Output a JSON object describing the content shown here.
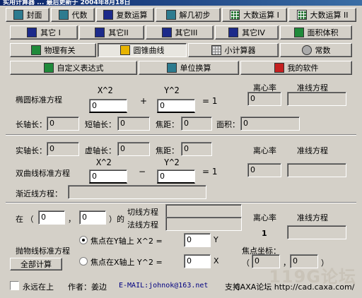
{
  "window": {
    "title_fragment": "实用计算器 ... 最后更新于 2004年8月18日"
  },
  "toolbar_row1": [
    {
      "label": "封面",
      "icon": "cover-icon"
    },
    {
      "label": "代数",
      "icon": "algebra-icon"
    },
    {
      "label": "复数运算",
      "icon": "complex-icon"
    },
    {
      "label": "解几初步",
      "icon": "analytic-geometry-icon"
    },
    {
      "label": "大数运算 I",
      "icon": "bignum-icon"
    },
    {
      "label": "大数运算 II",
      "icon": "bignum-icon"
    }
  ],
  "toolbar_row2": [
    {
      "label": "其它 I"
    },
    {
      "label": "其它II"
    },
    {
      "label": "其它III"
    },
    {
      "label": "其它IV"
    },
    {
      "label": "面积体积"
    }
  ],
  "tabs": [
    {
      "label": "物理有关"
    },
    {
      "label": "圆锥曲线",
      "active": true
    },
    {
      "label": "小计算器"
    },
    {
      "label": "常数"
    }
  ],
  "row4": [
    {
      "label": "自定义表达式"
    },
    {
      "label": "单位换算"
    },
    {
      "label": "我的软件"
    }
  ],
  "ellipse": {
    "title": "椭圆标准方程",
    "x2": "X^2",
    "y2": "Y^2",
    "plus": "+",
    "eq1": "= 1",
    "a_value": "0",
    "b_value": "0",
    "ecc_label": "离心率",
    "ecc_value": "0",
    "directrix_label": "准线方程",
    "major_label": "长轴长：",
    "major_value": "0",
    "minor_label": "短轴长：",
    "minor_value": "0",
    "focal_label": "焦距：",
    "focal_value": "0",
    "area_label": "面积：",
    "area_value": "0"
  },
  "hyperbola": {
    "real_label": "实轴长：",
    "real_value": "0",
    "imag_label": "虚轴长：",
    "imag_value": "0",
    "focal_label": "焦距：",
    "focal_value": "0",
    "ecc_label": "离心率",
    "directrix_label": "准线方程",
    "title": "双曲线标准方程",
    "x2": "X^2",
    "y2": "Y^2",
    "minus": "−",
    "eq1": "= 1",
    "a_value": "0",
    "b_value": "0",
    "ecc_value": "0",
    "asymptote_label": "渐近线方程："
  },
  "parabola": {
    "at_label": "在 （",
    "comma": "，",
    "x_value": "0",
    "y_value": "0",
    "paren_close": "）的",
    "tangent_label": "切线方程",
    "normal_label": "法线方程",
    "ecc_label": "离心率",
    "directrix_label": "准线方程",
    "ecc_value": "1",
    "title": "抛物线标准方程",
    "opt1_label": "焦点在Y轴上  X^2 =",
    "opt1_value": "0",
    "opt1_var": "Y",
    "opt2_label": "焦点在X轴上  Y^2 =",
    "opt2_value": "0",
    "opt2_var": "X",
    "focus_label": "焦点坐标：",
    "focus_open": "（",
    "focus_x": "0",
    "focus_comma": "，",
    "focus_y": "0",
    "focus_close": "）",
    "calc_all": "全部计算"
  },
  "footer": {
    "always_on_top": "永远在上",
    "author": "作者：姜边",
    "email": "E-MAIL:johnok@163.net",
    "support": "支持",
    "forum": "CAXA论坛 http://cad.caxa.com/",
    "watermark": "119G论坛"
  }
}
